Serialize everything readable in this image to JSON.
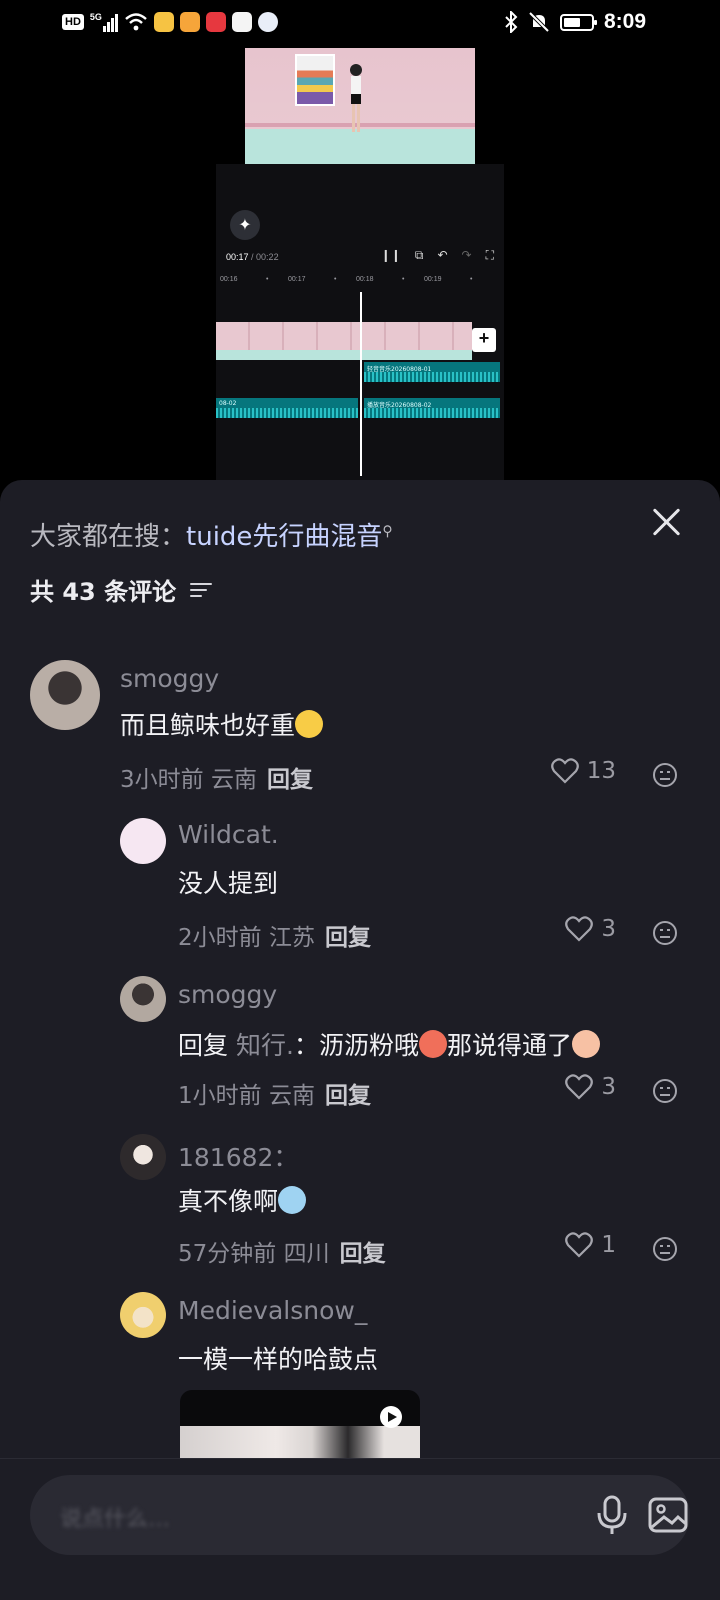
{
  "status_bar": {
    "hd": "HD",
    "network": "5G",
    "time": "8:09",
    "battery_level": 0.6,
    "icons": [
      "hd-icon",
      "signal-icon",
      "wifi-icon",
      "weibo-app-icon",
      "video-app-icon",
      "red-app-icon",
      "music-app-icon",
      "qq-app-icon",
      "bluetooth-icon",
      "mute-icon",
      "battery-icon"
    ]
  },
  "editor": {
    "current_time": "00:17",
    "total_time": "/ 00:22",
    "ruler": [
      "00:16",
      "00:17",
      "00:18",
      "00:19"
    ],
    "audio_tracks": [
      "轻音音乐20260808-01",
      "08-02",
      "播放音乐20260808-02"
    ],
    "add_clip": "+",
    "magic_icon": "✦"
  },
  "comments_panel": {
    "search_prefix": "大家都在搜：",
    "search_keyword": "tuide先行曲混音",
    "total_comments": "共 43 条评论",
    "input_placeholder": "说点什么…"
  },
  "comments": [
    {
      "username": "smoggy",
      "text": "而且鲸味也好重",
      "emoji": "crying-face-emoji",
      "time": "3小时前",
      "location": "云南",
      "reply_label": "回复",
      "likes": "13",
      "avatar_color": "#9a8f88"
    },
    {
      "username": "Wildcat.",
      "text": "没人提到",
      "time": "2小时前",
      "location": "江苏",
      "reply_label": "回复",
      "likes": "3",
      "avatar_color": "#f6e7f2"
    },
    {
      "username": "smoggy",
      "reply_prefix": "回复",
      "quoted_user": "知行.",
      "text": "沥沥粉哦",
      "text2": "那说得通了",
      "time": "1小时前",
      "location": "云南",
      "reply_label": "回复",
      "likes": "3",
      "avatar_color": "#8e857f"
    },
    {
      "username": "181682：",
      "text": "真不像啊",
      "time": "57分钟前",
      "location": "四川",
      "reply_label": "回复",
      "likes": "1",
      "avatar_color": "#4a4246"
    },
    {
      "username": "Medievalsnow_",
      "text": "一模一样的哈鼓点",
      "avatar_color": "#f1d9a0"
    }
  ],
  "colors": {
    "sheet_bg": "#1d1d25",
    "keyword": "#c7d3ff",
    "muted_text": "#8c8c96"
  }
}
